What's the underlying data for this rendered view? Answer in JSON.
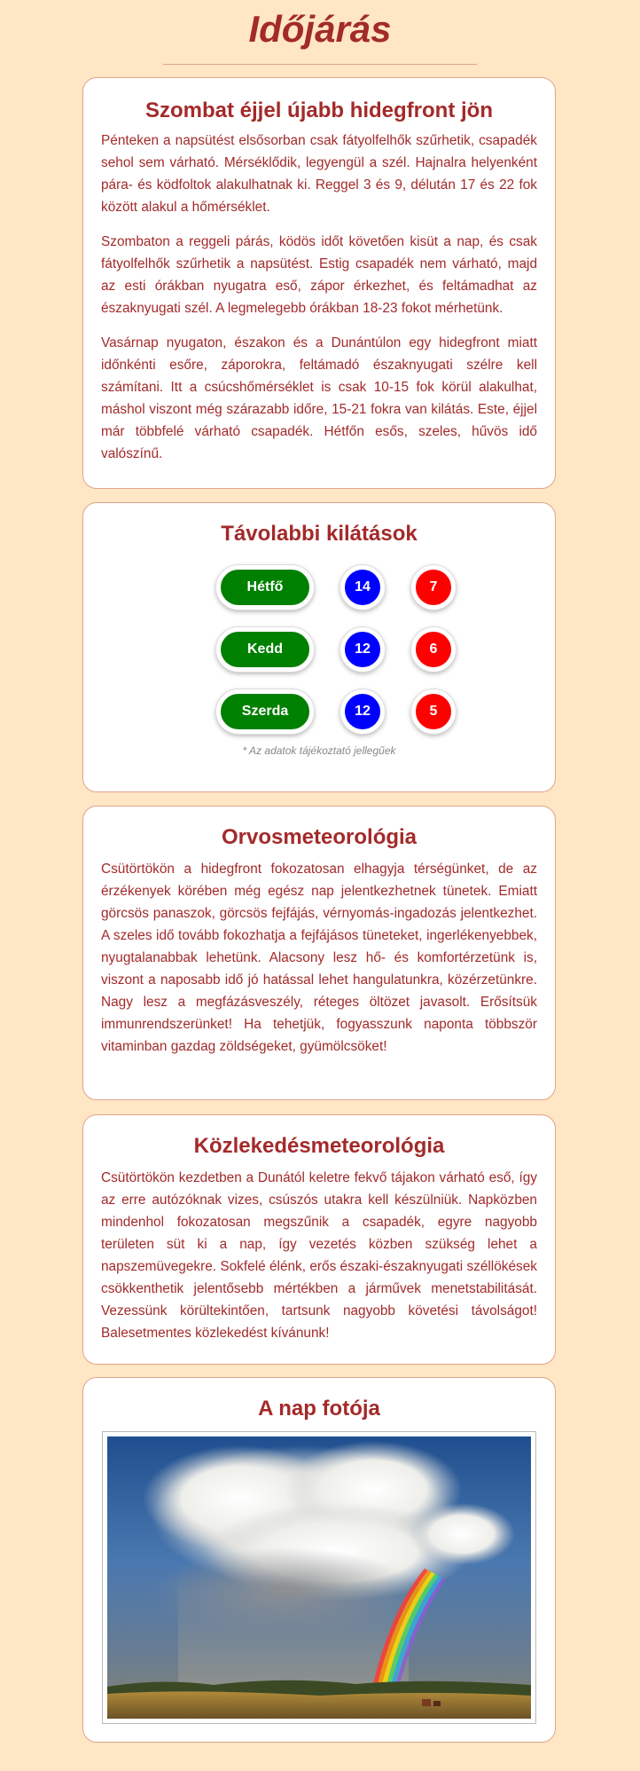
{
  "page": {
    "title": "Időjárás"
  },
  "weather": {
    "heading": "Szombat éjjel újabb hidegfront jön",
    "paragraphs": [
      "Pénteken a napsütést elsősorban csak fátyolfelhők szűrhetik, csapadék sehol sem várható. Mérséklődik, legyengül a szél. Hajnalra helyenként pára- és ködfoltok alakulhatnak ki. Reggel 3 és 9, délután 17 és 22 fok között alakul a hőmérséklet.",
      "Szombaton a reggeli párás, ködös időt követően kisüt a nap, és csak fátyolfelhők szűrhetik a napsütést. Estig csapadék nem várható, majd az esti órákban nyugatra eső, zápor érkezhet, és feltámadhat az északnyugati szél. A legmelegebb órákban 18-23 fokot mérhetünk.",
      "Vasárnap nyugaton, északon és a Dunántúlon egy hidegfront miatt időnkénti esőre, záporokra, feltámadó északnyugati szélre kell számítani. Itt a csúcshőmérséklet is csak 10-15 fok körül alakulhat, máshol viszont még szárazabb időre, 15-21 fokra van kilátás. Este, éjjel már többfelé várható csapadék. Hétfőn esős, szeles, hűvös idő valószínű."
    ]
  },
  "outlook": {
    "heading": "Távolabbi kilátások",
    "days": [
      {
        "day": "Hétfő",
        "max": "14",
        "min": "7"
      },
      {
        "day": "Kedd",
        "max": "12",
        "min": "6"
      },
      {
        "day": "Szerda",
        "max": "12",
        "min": "5"
      }
    ],
    "disclaimer": "* Az adatok tájékoztató jellegűek",
    "colors": {
      "day": "#008000",
      "max": "#0000ff",
      "min": "#ff0000"
    }
  },
  "medical": {
    "heading": "Orvosmeteorológia",
    "text": "Csütörtökön a hidegfront fokozatosan elhagyja térségünket, de az érzékenyek körében még egész nap jelentkezhetnek tünetek. Emiatt görcsös panaszok, görcsös fejfájás, vérnyomás-ingadozás jelentkezhet. A szeles idő tovább fokozhatja a fejfájásos tüneteket, ingerlékenyebbek, nyugtalanabbak lehetünk. Alacsony lesz hő- és komfortérzetünk is, viszont a naposabb idő jó hatással lehet hangulatunkra, közérzetünkre. Nagy lesz a megfázásveszély, réteges öltözet javasolt. Erősítsük immunrendszerünket! Ha tehetjük, fogyasszunk naponta többször vitaminban gazdag zöldségeket, gyümölcsöket!"
  },
  "traffic": {
    "heading": "Közlekedésmeteorológia",
    "text": "Csütörtökön kezdetben a Dunától keletre fekvő tájakon várható eső, így az erre autózóknak vizes, csúszós utakra kell készülniük. Napközben mindenhol fokozatosan megszűnik a csapadék, egyre nagyobb területen süt ki a nap, így vezetés közben szükség lehet a napszemüvegekre. Sokfelé élénk, erős északi-északnyugati széllökések csökkenthetik jelentősebb mértékben a járművek menetstabilitását. Vezessünk körültekintően, tartsunk nagyobb követési távolságot! Balesetmentes közlekedést kívánunk!"
  },
  "photo": {
    "heading": "A nap fotója",
    "icon": "rainbow-landscape-photo"
  },
  "theme": {
    "background": "#ffe6c5",
    "accent": "#a32a2a",
    "border": "#e0a48a"
  }
}
